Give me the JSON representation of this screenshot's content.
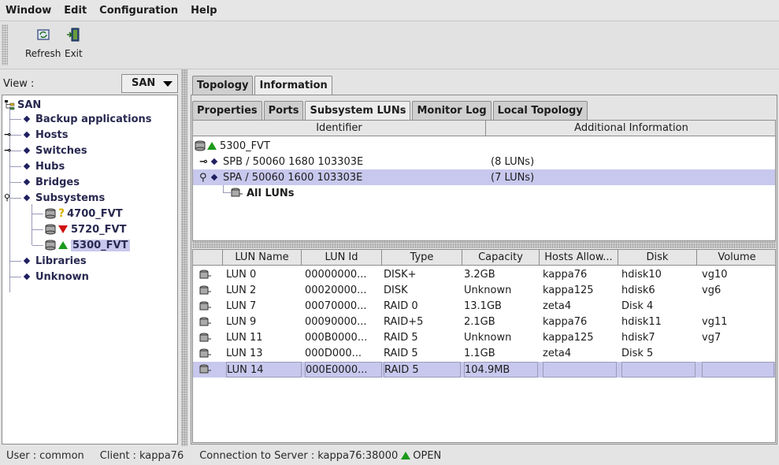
{
  "menu": {
    "items": [
      {
        "label": "Window"
      },
      {
        "label": "Edit"
      },
      {
        "label": "Configuration"
      },
      {
        "label": "Help"
      }
    ]
  },
  "toolbar": {
    "refresh_label": "Refresh",
    "exit_label": "Exit"
  },
  "view": {
    "label": "View :",
    "selected": "SAN"
  },
  "tree": {
    "root": "SAN",
    "items": [
      {
        "label": "Backup applications"
      },
      {
        "label": "Hosts"
      },
      {
        "label": "Switches"
      },
      {
        "label": "Hubs"
      },
      {
        "label": "Bridges"
      },
      {
        "label": "Subsystems"
      },
      {
        "label": "4700_FVT"
      },
      {
        "label": "5720_FVT"
      },
      {
        "label": "5300_FVT"
      },
      {
        "label": "Libraries"
      },
      {
        "label": "Unknown"
      }
    ]
  },
  "tabs": {
    "top": [
      {
        "label": "Topology"
      },
      {
        "label": "Information"
      }
    ],
    "sub": [
      {
        "label": "Properties"
      },
      {
        "label": "Ports"
      },
      {
        "label": "Subsystem LUNs"
      },
      {
        "label": "Monitor Log"
      },
      {
        "label": "Local Topology"
      }
    ]
  },
  "upper": {
    "headers": [
      "Identifier",
      "Additional Information"
    ],
    "rows": [
      {
        "identifier": "5300_FVT",
        "info": ""
      },
      {
        "identifier": "SPB / 50060 1680 103303E",
        "info": "(8 LUNs)"
      },
      {
        "identifier": "SPA / 50060 1600 103303E",
        "info": "(7 LUNs)"
      },
      {
        "identifier": "All LUNs",
        "info": ""
      }
    ]
  },
  "luns": {
    "headers": [
      "LUN Name",
      "LUN Id",
      "Type",
      "Capacity",
      "Hosts Allow...",
      "Disk",
      "Volume"
    ],
    "rows": [
      {
        "name": "LUN 0",
        "id": "00000000...",
        "type": "DISK+",
        "capacity": "3.2GB",
        "hosts": "kappa76",
        "disk": "hdisk10",
        "volume": "vg10"
      },
      {
        "name": "LUN 2",
        "id": "00020000...",
        "type": "DISK",
        "capacity": "Unknown",
        "hosts": "kappa125",
        "disk": "hdisk6",
        "volume": "vg6"
      },
      {
        "name": "LUN 7",
        "id": "00070000...",
        "type": "RAID 0",
        "capacity": "13.1GB",
        "hosts": "zeta4",
        "disk": "Disk 4",
        "volume": ""
      },
      {
        "name": "LUN 9",
        "id": "00090000...",
        "type": "RAID+5",
        "capacity": "2.1GB",
        "hosts": "kappa76",
        "disk": "hdisk11",
        "volume": "vg11"
      },
      {
        "name": "LUN 11",
        "id": "000B0000...",
        "type": "RAID 5",
        "capacity": "Unknown",
        "hosts": "kappa125",
        "disk": "hdisk7",
        "volume": "vg7"
      },
      {
        "name": "LUN 13",
        "id": "000D000...",
        "type": "RAID 5",
        "capacity": "1.1GB",
        "hosts": "zeta4",
        "disk": "Disk 5",
        "volume": ""
      },
      {
        "name": "LUN 14",
        "id": "000E0000...",
        "type": "RAID 5",
        "capacity": "104.9MB",
        "hosts": "",
        "disk": "",
        "volume": ""
      }
    ]
  },
  "status": {
    "user_label": "User :",
    "user": "common",
    "client_label": "Client :",
    "client": "kappa76",
    "conn_label": "Connection to Server :",
    "server": "kappa76:38000",
    "state": "OPEN"
  },
  "colors": {
    "selection": "#c8c8ee",
    "status_ok": "#1a9a1a",
    "status_error": "#d01010",
    "status_warning": "#d8b000"
  }
}
